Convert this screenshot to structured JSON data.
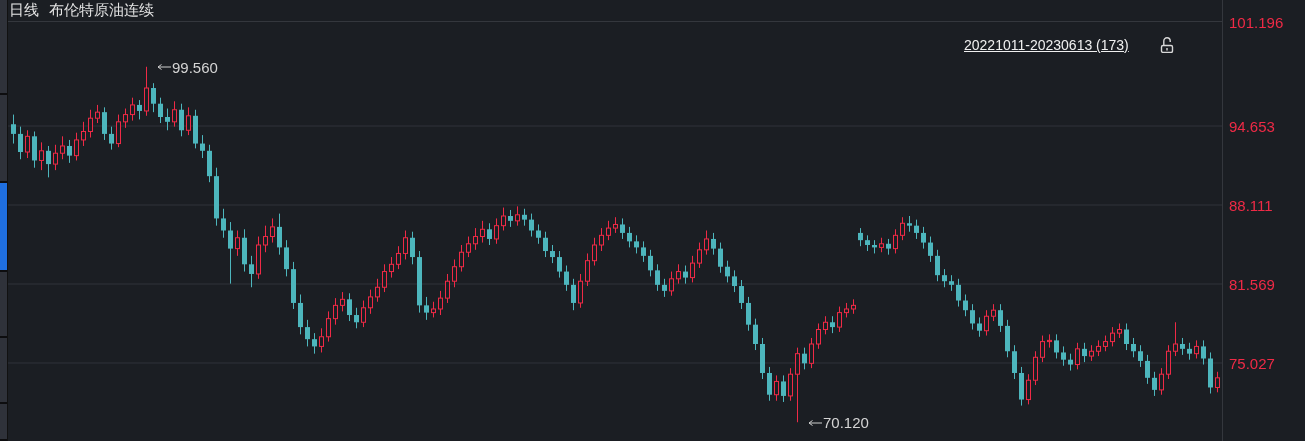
{
  "side_tabs": [
    {
      "selected": false
    },
    {
      "selected": false
    },
    {
      "selected": true
    },
    {
      "selected": false
    },
    {
      "selected": false
    },
    {
      "selected": false
    }
  ],
  "header": {
    "period": "日线",
    "instrument": "布伦特原油连续"
  },
  "range": {
    "label": "20221011-20230613 (173)",
    "locked": false
  },
  "axis_top_label": "101.196",
  "chart_data": {
    "type": "candlestick",
    "yticks": [
      {
        "value": 94.653,
        "label": "94.653"
      },
      {
        "value": 88.111,
        "label": "88.111"
      },
      {
        "value": 81.569,
        "label": "81.569"
      },
      {
        "value": 75.027,
        "label": "75.027"
      }
    ],
    "ylim": [
      68.65,
      103.35
    ],
    "grid": true,
    "annotations": [
      "99.560",
      "70.120"
    ],
    "ohlc": [
      [
        94.8,
        95.6,
        93.2,
        94.0
      ],
      [
        94.0,
        94.6,
        91.9,
        92.5
      ],
      [
        92.5,
        94.3,
        92.0,
        93.8
      ],
      [
        93.8,
        94.2,
        91.2,
        91.8
      ],
      [
        91.8,
        93.3,
        91.0,
        92.6
      ],
      [
        92.6,
        93.0,
        90.4,
        91.5
      ],
      [
        91.5,
        93.1,
        91.0,
        92.4
      ],
      [
        92.4,
        93.8,
        91.9,
        93.0
      ],
      [
        93.0,
        93.5,
        91.6,
        92.2
      ],
      [
        92.2,
        94.1,
        91.8,
        93.5
      ],
      [
        93.5,
        95.0,
        93.0,
        94.2
      ],
      [
        94.2,
        96.0,
        93.7,
        95.3
      ],
      [
        95.3,
        96.4,
        94.9,
        95.8
      ],
      [
        95.8,
        96.2,
        93.5,
        94.0
      ],
      [
        94.0,
        94.6,
        92.7,
        93.2
      ],
      [
        93.2,
        95.6,
        92.9,
        95.0
      ],
      [
        95.0,
        96.1,
        94.5,
        95.6
      ],
      [
        95.6,
        97.0,
        95.1,
        96.4
      ],
      [
        96.4,
        96.8,
        95.2,
        95.9
      ],
      [
        95.9,
        99.56,
        95.5,
        97.8
      ],
      [
        97.8,
        98.2,
        95.8,
        96.5
      ],
      [
        96.5,
        97.0,
        94.9,
        95.4
      ],
      [
        95.4,
        96.1,
        94.3,
        95.0
      ],
      [
        95.0,
        96.7,
        94.6,
        96.0
      ],
      [
        96.0,
        96.5,
        93.8,
        94.3
      ],
      [
        94.3,
        96.2,
        93.9,
        95.5
      ],
      [
        95.5,
        96.0,
        92.8,
        93.2
      ],
      [
        93.2,
        93.9,
        92.0,
        92.6
      ],
      [
        92.6,
        93.1,
        90.0,
        90.5
      ],
      [
        90.5,
        91.2,
        86.4,
        87.0
      ],
      [
        87.0,
        87.8,
        85.4,
        86.0
      ],
      [
        86.0,
        86.7,
        81.6,
        84.5
      ],
      [
        84.5,
        86.0,
        83.9,
        85.4
      ],
      [
        85.4,
        86.1,
        82.6,
        83.2
      ],
      [
        83.2,
        83.9,
        81.3,
        82.4
      ],
      [
        82.4,
        85.5,
        82.0,
        84.8
      ],
      [
        84.8,
        86.4,
        84.2,
        85.5
      ],
      [
        85.5,
        87.0,
        85.0,
        86.3
      ],
      [
        86.3,
        87.4,
        84.0,
        84.6
      ],
      [
        84.6,
        85.2,
        82.2,
        82.8
      ],
      [
        82.8,
        83.4,
        79.5,
        80.0
      ],
      [
        80.0,
        80.7,
        77.4,
        78.0
      ],
      [
        78.0,
        78.6,
        76.4,
        77.0
      ],
      [
        77.0,
        77.5,
        75.8,
        76.4
      ],
      [
        76.4,
        77.9,
        75.9,
        77.2
      ],
      [
        77.2,
        79.3,
        76.8,
        78.7
      ],
      [
        78.7,
        80.4,
        78.2,
        79.8
      ],
      [
        79.8,
        80.9,
        79.3,
        80.3
      ],
      [
        80.3,
        80.8,
        78.5,
        79.0
      ],
      [
        79.0,
        79.6,
        77.9,
        78.4
      ],
      [
        78.4,
        80.2,
        78.0,
        79.6
      ],
      [
        79.6,
        81.1,
        79.1,
        80.5
      ],
      [
        80.5,
        82.0,
        80.1,
        81.3
      ],
      [
        81.3,
        83.2,
        80.9,
        82.6
      ],
      [
        82.6,
        83.8,
        82.1,
        83.2
      ],
      [
        83.2,
        84.7,
        82.8,
        84.1
      ],
      [
        84.1,
        86.0,
        83.6,
        85.4
      ],
      [
        85.4,
        85.9,
        83.2,
        83.8
      ],
      [
        83.8,
        84.3,
        79.2,
        79.8
      ],
      [
        79.8,
        80.5,
        78.6,
        79.2
      ],
      [
        79.2,
        80.1,
        78.8,
        79.5
      ],
      [
        79.5,
        81.0,
        79.0,
        80.4
      ],
      [
        80.4,
        82.4,
        80.0,
        81.8
      ],
      [
        81.8,
        83.6,
        81.3,
        83.0
      ],
      [
        83.0,
        84.8,
        82.6,
        84.2
      ],
      [
        84.2,
        85.5,
        83.8,
        84.9
      ],
      [
        84.9,
        86.2,
        84.4,
        85.5
      ],
      [
        85.5,
        86.8,
        85.0,
        86.1
      ],
      [
        86.1,
        86.6,
        84.8,
        85.3
      ],
      [
        85.3,
        87.0,
        84.9,
        86.4
      ],
      [
        86.4,
        87.9,
        86.0,
        87.2
      ],
      [
        87.2,
        87.7,
        86.3,
        86.8
      ],
      [
        86.8,
        88.0,
        86.4,
        87.3
      ],
      [
        87.3,
        87.8,
        86.4,
        86.9
      ],
      [
        86.9,
        87.4,
        85.5,
        86.0
      ],
      [
        86.0,
        86.5,
        84.9,
        85.4
      ],
      [
        85.4,
        85.9,
        83.8,
        84.3
      ],
      [
        84.3,
        84.8,
        83.3,
        83.8
      ],
      [
        83.8,
        84.3,
        82.1,
        82.6
      ],
      [
        82.6,
        83.1,
        81.0,
        81.5
      ],
      [
        81.5,
        82.0,
        79.4,
        80.0
      ],
      [
        80.0,
        82.4,
        79.6,
        81.8
      ],
      [
        81.8,
        84.1,
        81.4,
        83.5
      ],
      [
        83.5,
        85.4,
        83.1,
        84.8
      ],
      [
        84.8,
        86.2,
        84.3,
        85.6
      ],
      [
        85.6,
        86.8,
        85.2,
        86.2
      ],
      [
        86.2,
        87.1,
        85.8,
        86.5
      ],
      [
        86.5,
        87.0,
        85.3,
        85.8
      ],
      [
        85.8,
        86.3,
        84.6,
        85.1
      ],
      [
        85.1,
        85.6,
        84.1,
        84.6
      ],
      [
        84.6,
        85.1,
        83.4,
        83.9
      ],
      [
        83.9,
        84.4,
        82.2,
        82.7
      ],
      [
        82.7,
        83.2,
        81.0,
        81.5
      ],
      [
        81.5,
        82.0,
        80.5,
        81.0
      ],
      [
        81.0,
        82.6,
        80.6,
        82.0
      ],
      [
        82.0,
        83.2,
        81.6,
        82.6
      ],
      [
        82.6,
        83.1,
        81.6,
        82.1
      ],
      [
        82.1,
        83.9,
        81.7,
        83.3
      ],
      [
        83.3,
        85.0,
        82.9,
        84.4
      ],
      [
        84.4,
        86.0,
        84.0,
        85.3
      ],
      [
        85.3,
        85.8,
        84.0,
        84.5
      ],
      [
        84.5,
        85.0,
        82.5,
        83.0
      ],
      [
        83.0,
        83.5,
        81.7,
        82.2
      ],
      [
        82.2,
        82.7,
        80.9,
        81.4
      ],
      [
        81.4,
        81.9,
        79.5,
        80.0
      ],
      [
        80.0,
        80.5,
        77.7,
        78.2
      ],
      [
        78.2,
        78.7,
        76.1,
        76.6
      ],
      [
        76.6,
        77.1,
        73.7,
        74.2
      ],
      [
        74.2,
        74.7,
        71.9,
        72.4
      ],
      [
        72.4,
        74.0,
        71.9,
        73.5
      ],
      [
        73.5,
        74.0,
        71.8,
        72.3
      ],
      [
        72.3,
        74.6,
        71.9,
        74.1
      ],
      [
        74.1,
        76.3,
        70.12,
        75.8
      ],
      [
        75.8,
        76.3,
        74.5,
        75.0
      ],
      [
        75.0,
        77.1,
        74.6,
        76.6
      ],
      [
        76.6,
        78.3,
        76.2,
        77.8
      ],
      [
        77.8,
        78.9,
        77.4,
        78.4
      ],
      [
        78.4,
        78.9,
        77.5,
        78.0
      ],
      [
        78.0,
        79.7,
        77.6,
        79.2
      ],
      [
        79.2,
        80.0,
        78.8,
        79.5
      ],
      [
        79.5,
        80.3,
        79.1,
        79.8
      ],
      [
        85.8,
        86.2,
        84.7,
        85.2
      ],
      [
        85.2,
        85.6,
        84.3,
        84.8
      ],
      [
        84.8,
        85.2,
        84.1,
        84.6
      ],
      [
        84.6,
        85.4,
        84.2,
        84.9
      ],
      [
        84.9,
        85.3,
        84.0,
        84.5
      ],
      [
        84.5,
        86.1,
        84.1,
        85.6
      ],
      [
        85.6,
        87.1,
        85.2,
        86.6
      ],
      [
        86.6,
        87.2,
        85.9,
        86.4
      ],
      [
        86.4,
        86.9,
        85.3,
        85.8
      ],
      [
        85.8,
        86.3,
        84.5,
        85.0
      ],
      [
        85.0,
        85.5,
        83.4,
        83.9
      ],
      [
        83.9,
        84.4,
        81.8,
        82.3
      ],
      [
        82.3,
        82.8,
        81.3,
        81.8
      ],
      [
        81.8,
        82.3,
        81.0,
        81.5
      ],
      [
        81.5,
        82.0,
        79.7,
        80.2
      ],
      [
        80.2,
        80.7,
        78.9,
        79.4
      ],
      [
        79.4,
        79.9,
        77.8,
        78.3
      ],
      [
        78.3,
        78.8,
        77.2,
        77.7
      ],
      [
        77.7,
        79.4,
        77.3,
        78.9
      ],
      [
        78.9,
        79.9,
        78.5,
        79.4
      ],
      [
        79.4,
        79.9,
        77.6,
        78.1
      ],
      [
        78.1,
        78.6,
        75.5,
        76.0
      ],
      [
        76.0,
        76.5,
        73.7,
        74.2
      ],
      [
        74.2,
        74.7,
        71.5,
        72.0
      ],
      [
        72.0,
        74.1,
        71.6,
        73.6
      ],
      [
        73.6,
        76.0,
        73.2,
        75.5
      ],
      [
        75.5,
        77.3,
        75.1,
        76.8
      ],
      [
        76.8,
        77.4,
        76.3,
        76.9
      ],
      [
        76.9,
        77.4,
        75.4,
        75.9
      ],
      [
        75.9,
        76.4,
        74.8,
        75.3
      ],
      [
        75.3,
        75.8,
        74.4,
        74.9
      ],
      [
        74.9,
        76.7,
        74.5,
        76.2
      ],
      [
        76.2,
        76.7,
        75.1,
        75.6
      ],
      [
        75.6,
        76.5,
        75.2,
        76.0
      ],
      [
        76.0,
        76.9,
        75.6,
        76.4
      ],
      [
        76.4,
        77.3,
        76.0,
        76.8
      ],
      [
        76.8,
        78.0,
        76.4,
        77.5
      ],
      [
        77.5,
        78.3,
        77.1,
        77.8
      ],
      [
        77.8,
        78.3,
        76.1,
        76.6
      ],
      [
        76.6,
        77.1,
        75.5,
        76.0
      ],
      [
        76.0,
        76.5,
        74.7,
        75.2
      ],
      [
        75.2,
        75.7,
        73.3,
        73.8
      ],
      [
        73.8,
        74.3,
        72.3,
        72.8
      ],
      [
        72.8,
        74.6,
        72.4,
        74.1
      ],
      [
        74.1,
        76.5,
        73.7,
        76.0
      ],
      [
        76.0,
        78.4,
        75.6,
        76.6
      ],
      [
        76.6,
        77.1,
        75.7,
        76.2
      ],
      [
        76.2,
        76.7,
        75.3,
        75.8
      ],
      [
        75.8,
        76.9,
        75.4,
        76.4
      ],
      [
        76.4,
        76.9,
        74.9,
        75.4
      ],
      [
        75.4,
        75.9,
        72.5,
        73.0
      ],
      [
        73.0,
        74.3,
        72.6,
        73.8
      ]
    ]
  }
}
